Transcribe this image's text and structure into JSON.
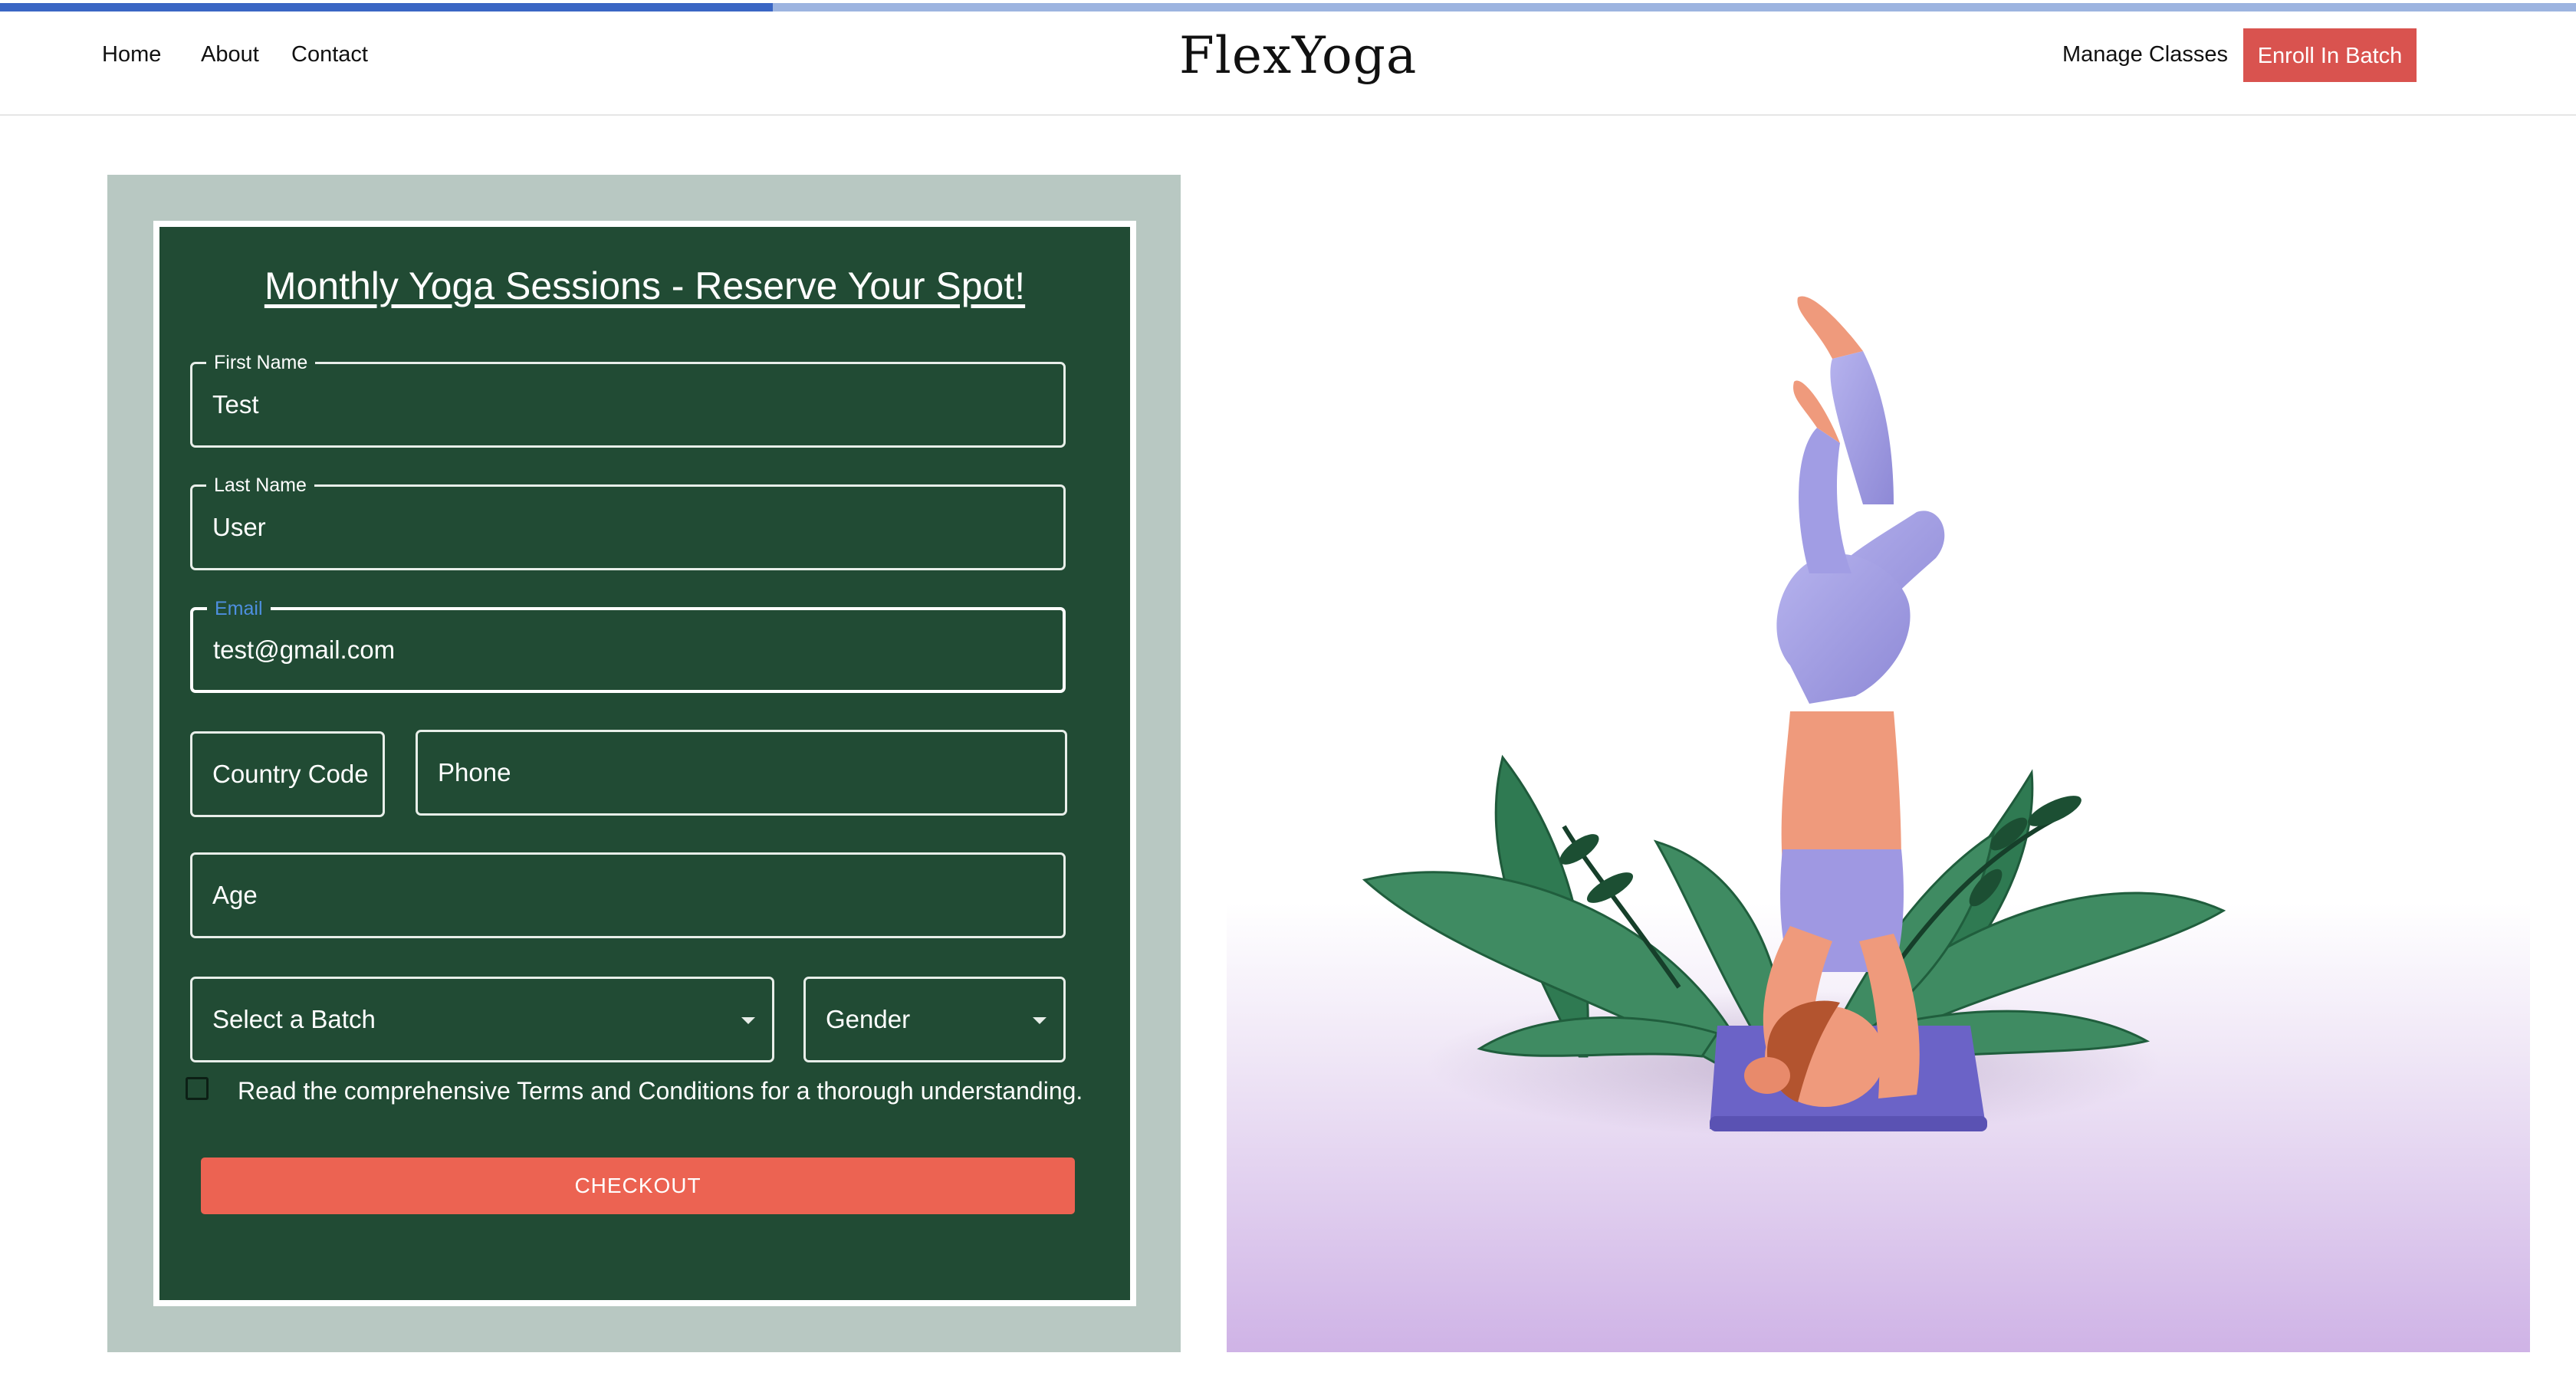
{
  "progress": {
    "fraction": 0.3
  },
  "nav": {
    "home": "Home",
    "about": "About",
    "contact": "Contact",
    "brand": "FlexYoga",
    "manage": "Manage Classes",
    "enroll": "Enroll In Batch"
  },
  "form": {
    "title": "Monthly Yoga Sessions - Reserve Your Spot!",
    "first_name": {
      "label": "First Name",
      "value": "Test"
    },
    "last_name": {
      "label": "Last Name",
      "value": "User"
    },
    "email": {
      "label": "Email",
      "value": "test@gmail.com"
    },
    "country_code": {
      "placeholder": "Country Code"
    },
    "phone": {
      "placeholder": "Phone"
    },
    "age": {
      "placeholder": "Age"
    },
    "batch": {
      "placeholder": "Select a Batch"
    },
    "gender": {
      "placeholder": "Gender"
    },
    "terms": "Read the comprehensive Terms and Conditions for a thorough understanding.",
    "checkout": "CHECKOUT"
  },
  "colors": {
    "card": "#214b34",
    "panel": "#b8c8c2",
    "accent": "#ec6352",
    "enroll": "#d9534f",
    "focus_label": "#4e8fe0"
  },
  "illustration": {
    "icon": "yoga-headstand-illustration"
  }
}
